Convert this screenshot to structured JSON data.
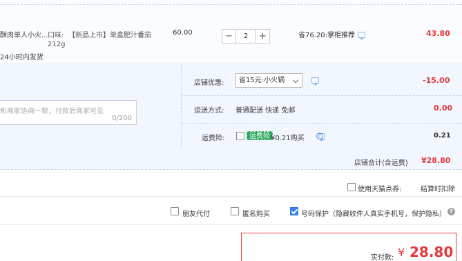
{
  "product": {
    "name_line1": "酥肉单人小火...",
    "shipping_note": "24小时内发货",
    "spec_label": "口味:",
    "spec_value": "【新品上市】单盒肥汁番茄",
    "spec_value2": "212g",
    "unit_price": "60.00",
    "quantity": "2",
    "minus_label": "−",
    "plus_label": "+",
    "discount_note": "省76.20:掌柜推荐",
    "subtotal": "43.80"
  },
  "shop": {
    "memo_placeholder": "和商家协商一致，付款后商家可见",
    "memo_counter": "0/200",
    "discount_label": "店铺优惠:",
    "discount_selected": "省15元:小火锅",
    "discount_amount": "-15.00",
    "delivery_label": "运送方式:",
    "delivery_value": "普通配送 快递 免邮",
    "delivery_amount": "0.00",
    "insurance_label": "运费险:",
    "insurance_badge": "运费险",
    "insurance_value": "¥0.21购买",
    "insurance_amount": "0.21",
    "shop_total_label": "店铺合计(含运费)",
    "shop_total_value": "¥28.80"
  },
  "tianmao": {
    "points_label": "使用天猫点券:",
    "points_note": "结算时扣除"
  },
  "options": {
    "friend_pay": "朋友代付",
    "anonymous": "匿名购买",
    "privacy": "号码保护（隐藏收件人真实手机号，保护隐私）"
  },
  "total": {
    "label": "实付款:",
    "currency": "¥",
    "value": "28.80"
  },
  "colors": {
    "accent_red": "#e4393c",
    "accent_blue": "#3b82f6",
    "badge_green": "#2aa65a"
  }
}
